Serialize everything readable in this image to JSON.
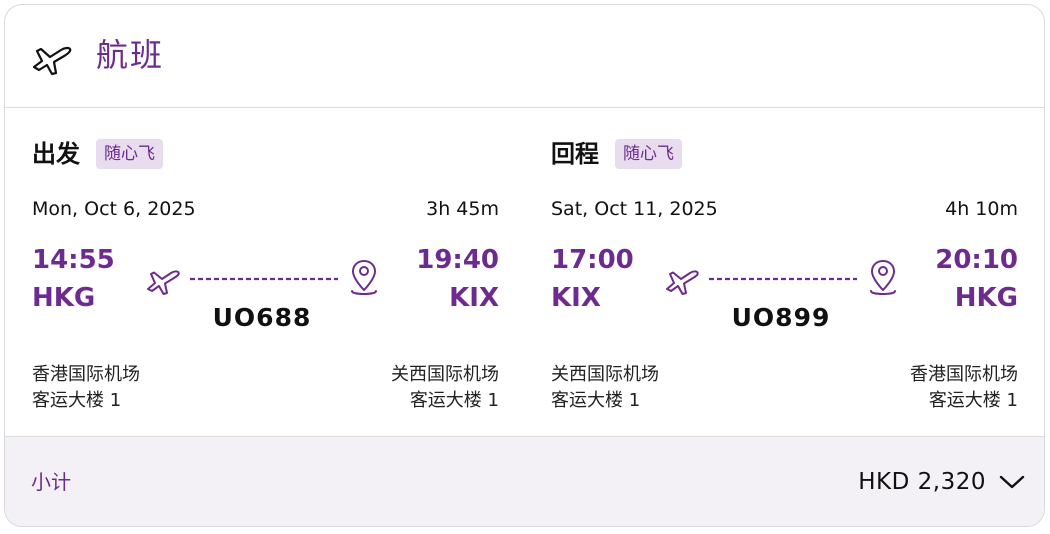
{
  "header": {
    "title": "航班",
    "icon": "plane-icon"
  },
  "outbound": {
    "title": "出发",
    "badge": "随心飞",
    "date": "Mon, Oct 6, 2025",
    "duration": "3h 45m",
    "departure": {
      "time": "14:55",
      "code": "HKG",
      "airport": "香港国际机场",
      "terminal": "客运大楼 1"
    },
    "arrival": {
      "time": "19:40",
      "code": "KIX",
      "airport": "关西国际机场",
      "terminal": "客运大楼 1"
    },
    "flight_number": "UO688"
  },
  "inbound": {
    "title": "回程",
    "badge": "随心飞",
    "date": "Sat, Oct 11, 2025",
    "duration": "4h 10m",
    "departure": {
      "time": "17:00",
      "code": "KIX",
      "airport": "关西国际机场",
      "terminal": "客运大楼 1"
    },
    "arrival": {
      "time": "20:10",
      "code": "HKG",
      "airport": "香港国际机场",
      "terminal": "客运大楼 1"
    },
    "flight_number": "UO899"
  },
  "footer": {
    "subtotal_label": "小计",
    "subtotal_value": "HKD 2,320",
    "expand_icon": "chevron-down-icon"
  },
  "colors": {
    "brand": "#6e2b8f",
    "badge_bg": "#e8dcef",
    "footer_bg": "#f3f1f6",
    "text": "#111111"
  }
}
